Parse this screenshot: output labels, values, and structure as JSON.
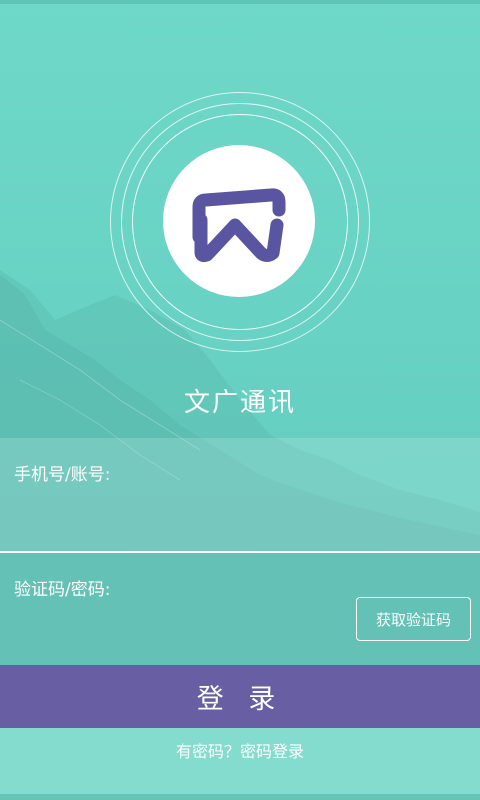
{
  "app": {
    "name": "文广通讯"
  },
  "login_form": {
    "account_label": "手机号/账号:",
    "account_value": "",
    "code_label": "验证码/密码:",
    "code_value": "",
    "get_code_button": "获取验证码",
    "submit_button": "登 录",
    "password_login_link": "有密码？密码登录"
  },
  "colors": {
    "background": "#6fd8c8",
    "primary_button": "#675ea3",
    "logo_mark": "#5a55a0",
    "text": "#ffffff"
  },
  "icons": {
    "logo": "wg-logo-icon"
  }
}
